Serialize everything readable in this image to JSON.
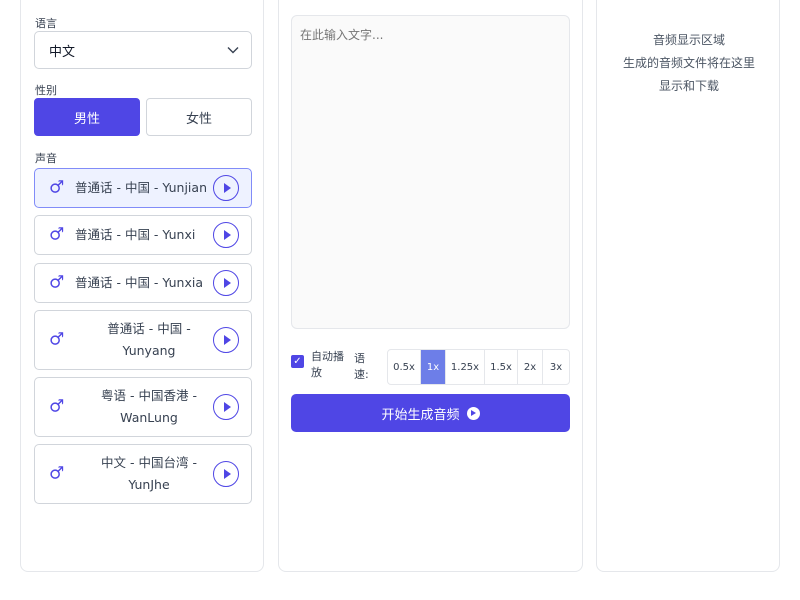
{
  "language": {
    "label": "语言",
    "selected": "中文"
  },
  "gender": {
    "label": "性别",
    "male": "男性",
    "female": "女性"
  },
  "voices": {
    "label": "声音",
    "items": [
      {
        "name": "普通话 - 中国 - Yunjian"
      },
      {
        "name": "普通话 - 中国 - Yunxi"
      },
      {
        "name": "普通话 - 中国 - Yunxia"
      },
      {
        "name": "普通话 - 中国 - Yunyang"
      },
      {
        "name": "粤语 - 中国香港 - WanLung"
      },
      {
        "name": "中文 - 中国台湾 - YunJhe"
      }
    ]
  },
  "editor": {
    "placeholder": "在此输入文字..."
  },
  "autoplay": {
    "label": "自动播放",
    "checked": true
  },
  "speed": {
    "label": "语速:",
    "options": [
      "0.5x",
      "1x",
      "1.25x",
      "1.5x",
      "2x",
      "3x"
    ],
    "selected": "1x"
  },
  "generate": {
    "label": "开始生成音频"
  },
  "audio": {
    "title": "音频显示区域",
    "line1": "生成的音频文件将在这里",
    "line2": "显示和下载"
  },
  "colors": {
    "accent": "#4f46e5",
    "speed_active": "#6d7ee8"
  }
}
